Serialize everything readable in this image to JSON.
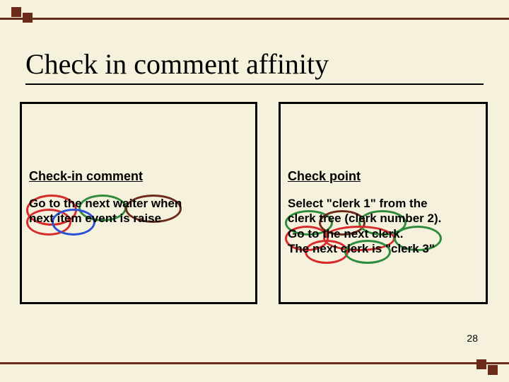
{
  "deco": {
    "color": "#6b2a1a"
  },
  "title": "Check in comment affinity",
  "left": {
    "heading": "Check-in comment",
    "body": "Go to the next waiter when\nnext item event is raise"
  },
  "right": {
    "heading": "Check point",
    "body": "Select \"clerk 1\" from the\nclerk tree (clerk number 2).\nGo to the next clerk.\nThe next clerk is \"clerk 3\""
  },
  "page_number": "28"
}
